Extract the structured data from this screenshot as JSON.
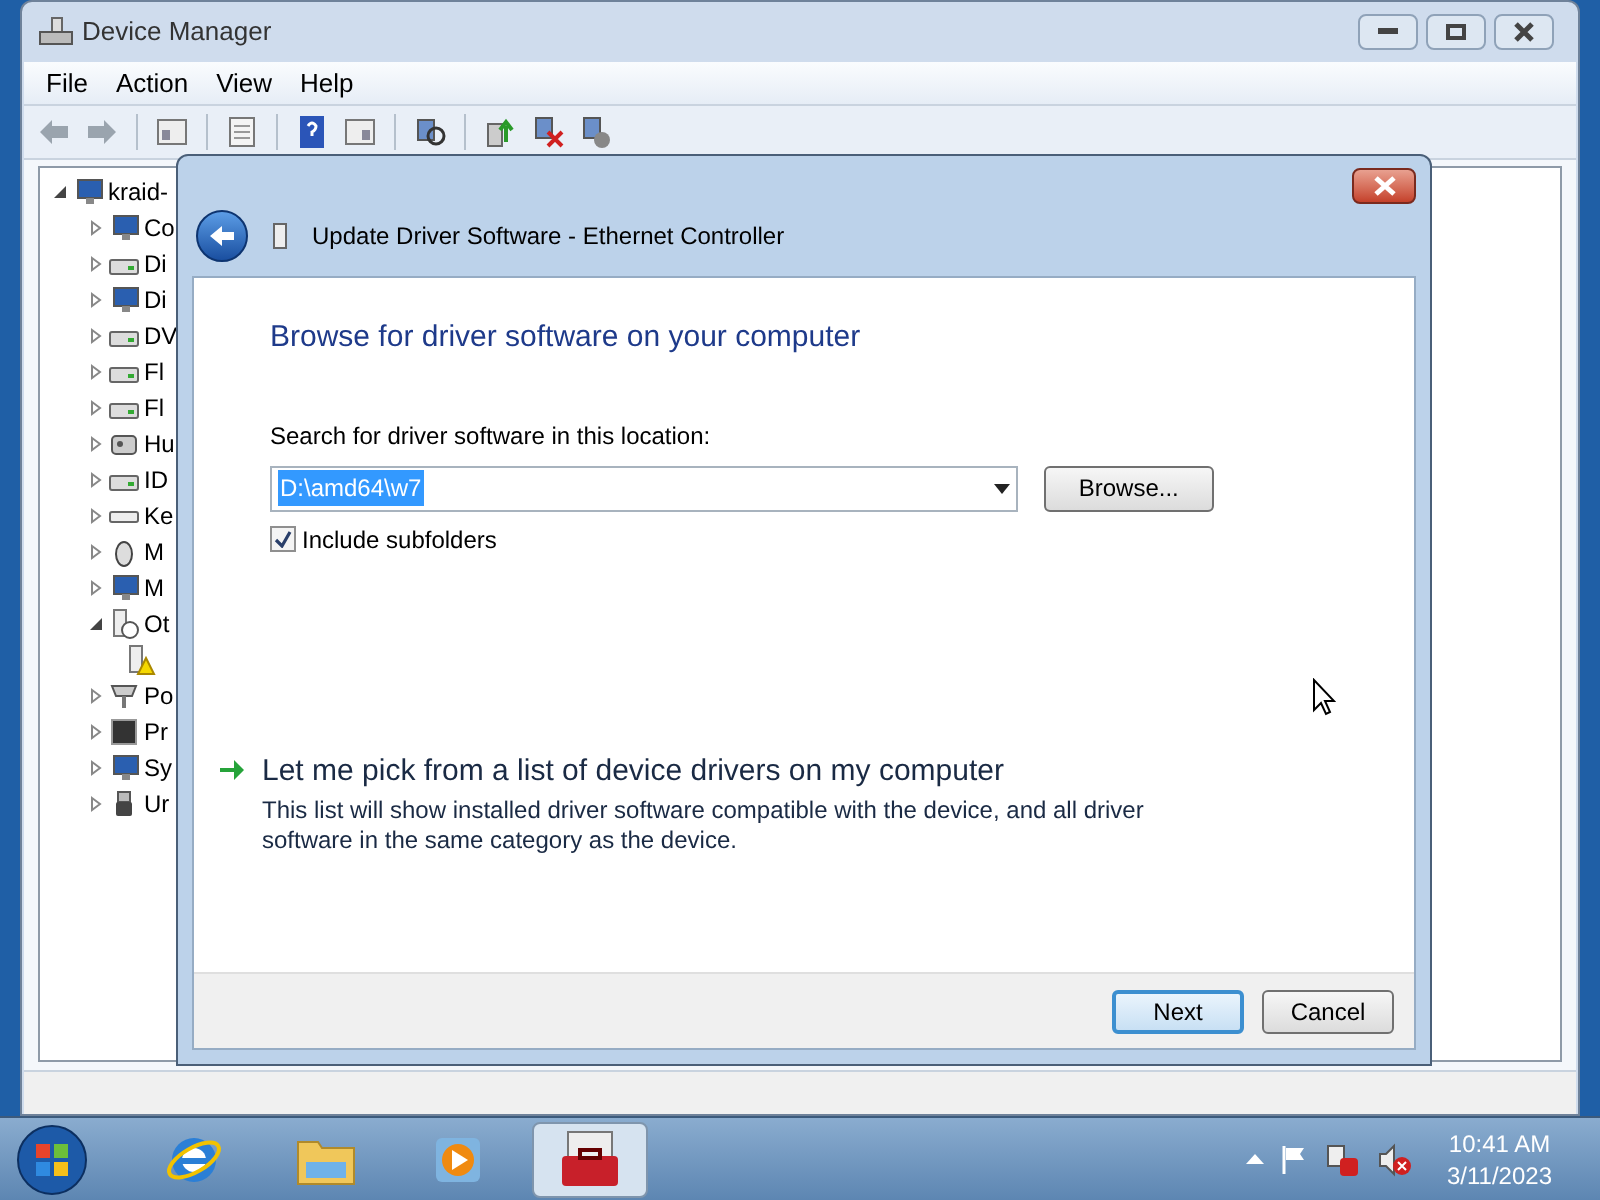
{
  "window": {
    "title": "Device Manager"
  },
  "menu": [
    "File",
    "Action",
    "View",
    "Help"
  ],
  "tree": {
    "root": {
      "label": "kraid-",
      "expanded": true
    },
    "children": [
      {
        "label": "Co",
        "kind": "computer",
        "expanded": false
      },
      {
        "label": "Di",
        "kind": "drive",
        "expanded": false
      },
      {
        "label": "Di",
        "kind": "display",
        "expanded": false
      },
      {
        "label": "DV",
        "kind": "drive",
        "expanded": false
      },
      {
        "label": "Fl",
        "kind": "drive",
        "expanded": false
      },
      {
        "label": "Fl",
        "kind": "drive",
        "expanded": false
      },
      {
        "label": "Hu",
        "kind": "hid",
        "expanded": false
      },
      {
        "label": "ID",
        "kind": "drive",
        "expanded": false
      },
      {
        "label": "Ke",
        "kind": "keyboard",
        "expanded": false
      },
      {
        "label": "M",
        "kind": "mouse",
        "expanded": false
      },
      {
        "label": "M",
        "kind": "display",
        "expanded": false
      },
      {
        "label": "Ot",
        "kind": "unknown",
        "expanded": true,
        "children": [
          {
            "kind": "warning"
          }
        ]
      },
      {
        "label": "Po",
        "kind": "port",
        "expanded": false
      },
      {
        "label": "Pr",
        "kind": "chip",
        "expanded": false
      },
      {
        "label": "Sy",
        "kind": "computer",
        "expanded": false
      },
      {
        "label": "Ur",
        "kind": "usb",
        "expanded": false
      }
    ]
  },
  "dialog": {
    "title": "Update Driver Software - Ethernet Controller",
    "heading": "Browse for driver software on your computer",
    "location_label": "Search for driver software in this location:",
    "location": {
      "value": "D:\\amd64\\w7",
      "selected": true
    },
    "browse_button": "Browse...",
    "include_subfolders": {
      "label": "Include subfolders",
      "checked": true
    },
    "pick_link": {
      "title": "Let me pick from a list of device drivers on my computer",
      "description": "This list will show installed driver software compatible with the device, and all driver software in the same category as the device."
    },
    "buttons": [
      {
        "label": "Next",
        "default": true
      },
      {
        "label": "Cancel",
        "default": false
      }
    ]
  },
  "taskbar": {
    "apps": [
      {
        "kind": "browser",
        "selected": false
      },
      {
        "kind": "folder",
        "selected": false
      },
      {
        "kind": "media",
        "selected": false
      },
      {
        "kind": "toolbox",
        "selected": true
      }
    ],
    "clock": {
      "time": "10:41 AM",
      "date": "3/11/2023"
    }
  }
}
